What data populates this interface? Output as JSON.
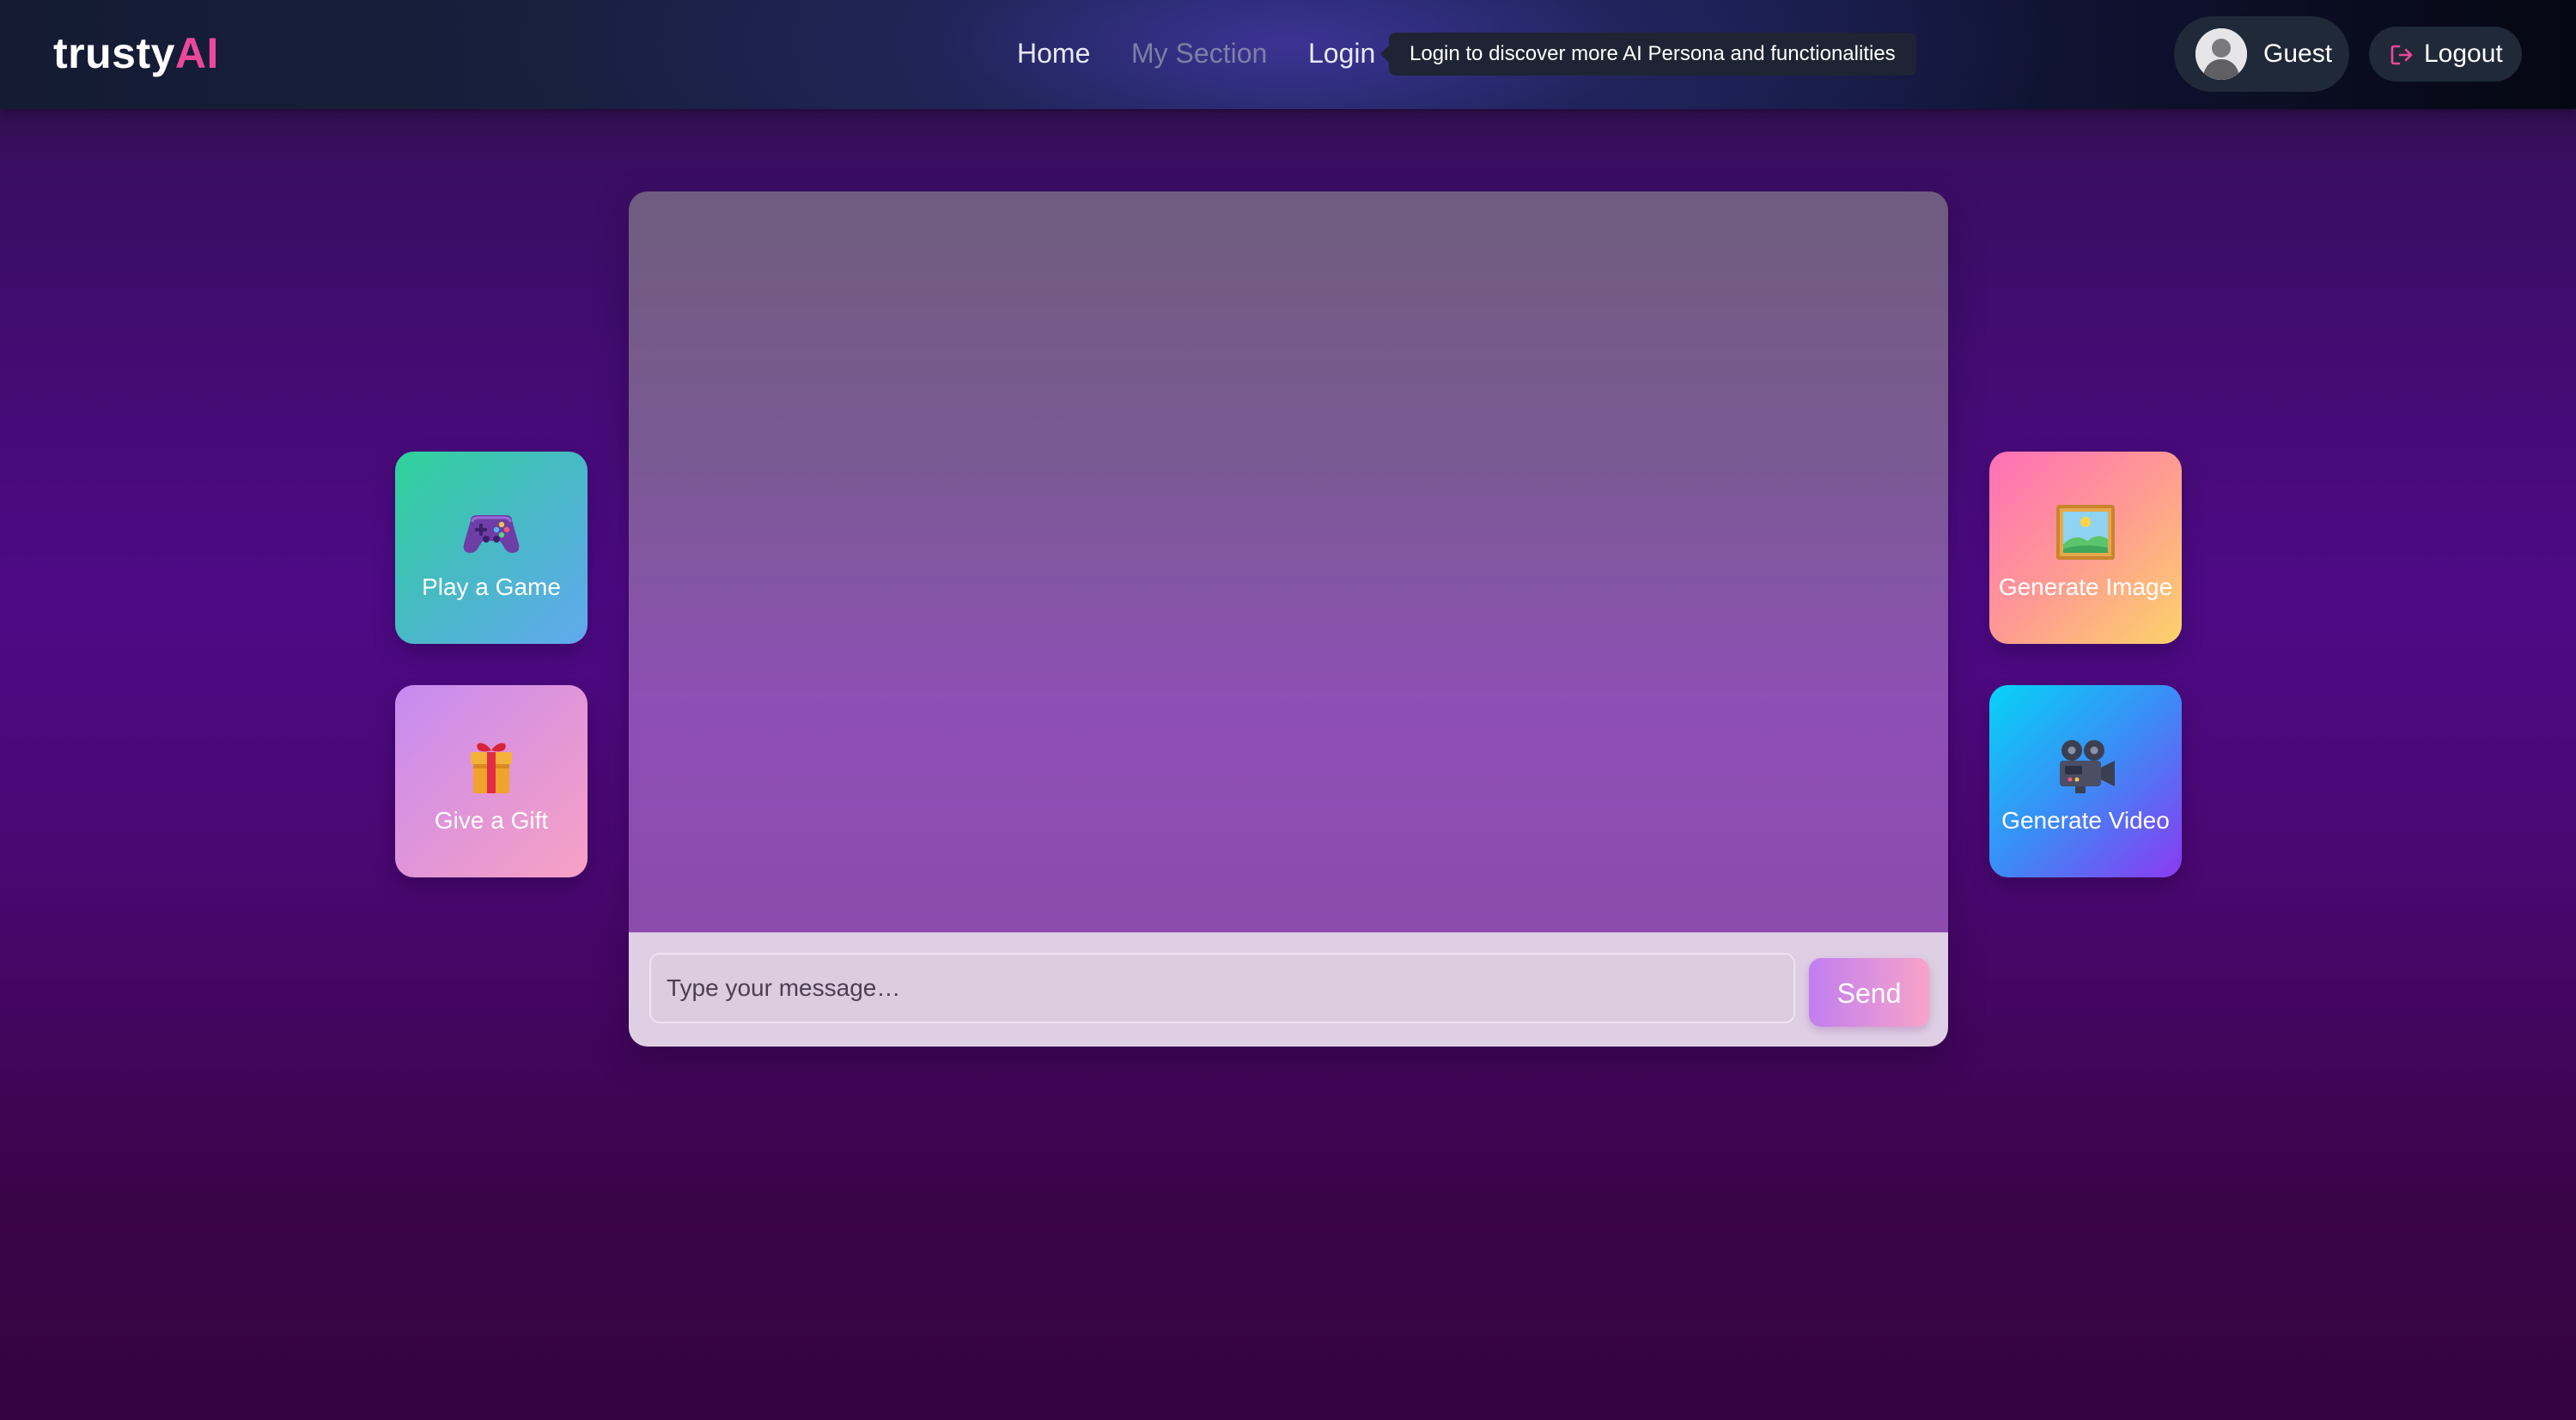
{
  "header": {
    "logo": {
      "main": "trusty",
      "accent": "AI"
    },
    "nav": {
      "home": "Home",
      "my_section": "My Section",
      "login": "Login"
    },
    "tooltip": "Login to discover more AI Persona and functionalities",
    "user": {
      "name": "Guest",
      "avatar_icon": "user-avatar-icon"
    },
    "logout_label": "Logout",
    "logout_icon": "logout-arrow-icon"
  },
  "actions": {
    "play_game": {
      "label": "Play a Game",
      "icon": "gamepad-icon"
    },
    "give_gift": {
      "label": "Give a Gift",
      "icon": "gift-icon"
    },
    "generate_image": {
      "label": "Generate Image",
      "icon": "framed-picture-icon"
    },
    "generate_video": {
      "label": "Generate Video",
      "icon": "movie-camera-icon"
    }
  },
  "chat": {
    "input_placeholder": "Type your message…",
    "input_value": "",
    "send_label": "Send"
  },
  "colors": {
    "logo_accent": "#ec4899",
    "nav_inactive": "#7d7fa6",
    "pill_bg": "#1f2938"
  }
}
